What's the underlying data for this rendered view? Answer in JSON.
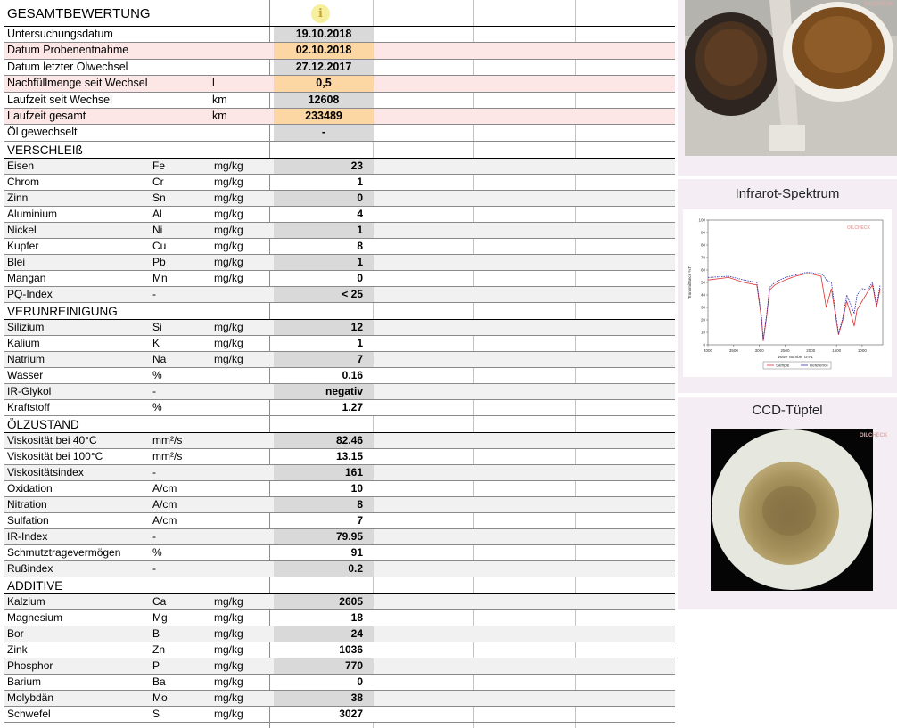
{
  "gesamt": {
    "title": "GESAMTBEWERTUNG",
    "info_icon": "info-icon",
    "rows": [
      {
        "label": "Untersuchungsdatum",
        "unit": "",
        "value": "19.10.2018"
      },
      {
        "label": "Datum Probenentnahme",
        "unit": "",
        "value": "02.10.2018"
      },
      {
        "label": "Datum letzter Ölwechsel",
        "unit": "",
        "value": "27.12.2017"
      },
      {
        "label": "Nachfüllmenge seit Wechsel",
        "unit": "l",
        "value": "0,5"
      },
      {
        "label": "Laufzeit seit Wechsel",
        "unit": "km",
        "value": "12608"
      },
      {
        "label": "Laufzeit gesamt",
        "unit": "km",
        "value": "233489"
      },
      {
        "label": "Öl gewechselt",
        "unit": "",
        "value": "-"
      }
    ]
  },
  "verschleiss": {
    "title": "VERSCHLEIß",
    "rows": [
      {
        "label": "Eisen",
        "symbol": "Fe",
        "unit": "mg/kg",
        "value": "23"
      },
      {
        "label": "Chrom",
        "symbol": "Cr",
        "unit": "mg/kg",
        "value": "1"
      },
      {
        "label": "Zinn",
        "symbol": "Sn",
        "unit": "mg/kg",
        "value": "0"
      },
      {
        "label": "Aluminium",
        "symbol": "Al",
        "unit": "mg/kg",
        "value": "4"
      },
      {
        "label": "Nickel",
        "symbol": "Ni",
        "unit": "mg/kg",
        "value": "1"
      },
      {
        "label": "Kupfer",
        "symbol": "Cu",
        "unit": "mg/kg",
        "value": "8"
      },
      {
        "label": "Blei",
        "symbol": "Pb",
        "unit": "mg/kg",
        "value": "1"
      },
      {
        "label": "Mangan",
        "symbol": "Mn",
        "unit": "mg/kg",
        "value": "0"
      },
      {
        "label": "PQ-Index",
        "symbol": "-",
        "unit": "",
        "value": "< 25"
      }
    ]
  },
  "verunreinigung": {
    "title": "VERUNREINIGUNG",
    "rows": [
      {
        "label": "Silizium",
        "symbol": "Si",
        "unit": "mg/kg",
        "value": "12"
      },
      {
        "label": "Kalium",
        "symbol": "K",
        "unit": "mg/kg",
        "value": "1"
      },
      {
        "label": "Natrium",
        "symbol": "Na",
        "unit": "mg/kg",
        "value": "7"
      },
      {
        "label": "Wasser",
        "symbol": "%",
        "unit": "",
        "value": "0.16"
      },
      {
        "label": "IR-Glykol",
        "symbol": "-",
        "unit": "",
        "value": "negativ"
      },
      {
        "label": "Kraftstoff",
        "symbol": "%",
        "unit": "",
        "value": "1.27"
      }
    ]
  },
  "oelzustand": {
    "title": "ÖLZUSTAND",
    "rows": [
      {
        "label": "Viskosität bei 40°C",
        "symbol": "mm²/s",
        "unit": "",
        "value": "82.46"
      },
      {
        "label": "Viskosität bei 100°C",
        "symbol": "mm²/s",
        "unit": "",
        "value": "13.15"
      },
      {
        "label": "Viskositätsindex",
        "symbol": "-",
        "unit": "",
        "value": "161"
      },
      {
        "label": "Oxidation",
        "symbol": "A/cm",
        "unit": "",
        "value": "10"
      },
      {
        "label": "Nitration",
        "symbol": "A/cm",
        "unit": "",
        "value": "8"
      },
      {
        "label": "Sulfation",
        "symbol": "A/cm",
        "unit": "",
        "value": "7"
      },
      {
        "label": "IR-Index",
        "symbol": "-",
        "unit": "",
        "value": "79.95"
      },
      {
        "label": "Schmutztragevermögen",
        "symbol": "%",
        "unit": "",
        "value": "91"
      },
      {
        "label": "Rußindex",
        "symbol": "-",
        "unit": "",
        "value": "0.2"
      }
    ]
  },
  "additive": {
    "title": "ADDITIVE",
    "rows": [
      {
        "label": "Kalzium",
        "symbol": "Ca",
        "unit": "mg/kg",
        "value": "2605"
      },
      {
        "label": "Magnesium",
        "symbol": "Mg",
        "unit": "mg/kg",
        "value": "18"
      },
      {
        "label": "Bor",
        "symbol": "B",
        "unit": "mg/kg",
        "value": "24"
      },
      {
        "label": "Zink",
        "symbol": "Zn",
        "unit": "mg/kg",
        "value": "1036"
      },
      {
        "label": "Phosphor",
        "symbol": "P",
        "unit": "mg/kg",
        "value": "770"
      },
      {
        "label": "Barium",
        "symbol": "Ba",
        "unit": "mg/kg",
        "value": "0"
      },
      {
        "label": "Molybdän",
        "symbol": "Mo",
        "unit": "mg/kg",
        "value": "38"
      },
      {
        "label": "Schwefel",
        "symbol": "S",
        "unit": "mg/kg",
        "value": "3027"
      }
    ]
  },
  "panels": {
    "ir_title": "Infrarot-Spektrum",
    "ccd_title": "CCD-Tüpfel",
    "watermark": "OILCHECK"
  },
  "ir_chart": {
    "type": "line",
    "xlabel": "Wave Number cm-1",
    "ylabel": "Transmittance %T",
    "x_ticks": [
      "4000",
      "3500",
      "3000",
      "2500",
      "2000",
      "1500",
      "1000"
    ],
    "y_ticks": [
      "100",
      "90",
      "80",
      "70",
      "60",
      "50",
      "40",
      "30",
      "20",
      "10",
      "0"
    ],
    "xlim": [
      4000,
      600
    ],
    "ylim": [
      0,
      100
    ],
    "legend": [
      "Sample",
      "Reference"
    ],
    "colors": {
      "sample": "#e03030",
      "reference": "#3030b0"
    },
    "series": [
      {
        "name": "Sample",
        "x": [
          4000,
          3600,
          3300,
          3050,
          2955,
          2924,
          2860,
          2800,
          2700,
          2500,
          2300,
          2200,
          2100,
          2000,
          1900,
          1800,
          1740,
          1700,
          1600,
          1460,
          1377,
          1300,
          1200,
          1155,
          1100,
          1000,
          900,
          800,
          720,
          650
        ],
        "y": [
          52,
          54,
          50,
          48,
          20,
          3,
          22,
          44,
          48,
          52,
          55,
          56,
          57,
          57,
          56,
          55,
          40,
          30,
          45,
          8,
          20,
          35,
          22,
          15,
          28,
          35,
          42,
          48,
          30,
          45
        ]
      },
      {
        "name": "Reference",
        "x": [
          4000,
          3600,
          3300,
          3050,
          2955,
          2924,
          2860,
          2800,
          2700,
          2500,
          2300,
          2200,
          2100,
          2000,
          1900,
          1800,
          1740,
          1700,
          1600,
          1460,
          1377,
          1300,
          1200,
          1155,
          1100,
          1000,
          900,
          800,
          720,
          650
        ],
        "y": [
          54,
          55,
          52,
          50,
          22,
          4,
          24,
          46,
          50,
          54,
          56,
          57,
          58,
          58,
          57,
          57,
          55,
          52,
          50,
          9,
          22,
          40,
          30,
          25,
          40,
          45,
          44,
          50,
          32,
          48
        ]
      }
    ]
  }
}
